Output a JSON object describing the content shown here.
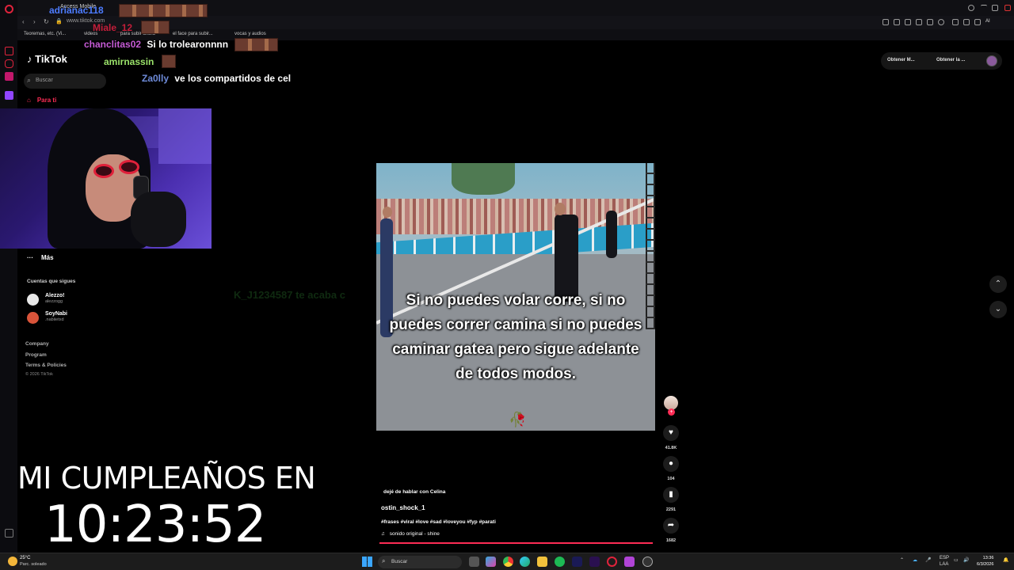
{
  "browser": {
    "tab_title": "Access Mobile",
    "url": "www.tiktok.com",
    "bookmarks": [
      "Teoremas, etc. (Vi...",
      "videos",
      "para subir ahora",
      "el face para subir...",
      "vocas y audios"
    ]
  },
  "tiktok": {
    "logo": "TikTok",
    "search_placeholder": "Buscar",
    "nav_home": "Para ti",
    "nav_more": "Más",
    "following_title": "Cuentas que sigues",
    "following": [
      {
        "name": "Alezzo!",
        "handle": "alezzogg"
      },
      {
        "name": "SoyNabi",
        "handle": ".nabiietxd"
      }
    ],
    "footer": [
      "Company",
      "Program",
      "Terms & Policies"
    ],
    "copyright": "© 2026 TikTok",
    "top_buttons": [
      "Obtener M...",
      "Obtener la ..."
    ]
  },
  "chat": [
    {
      "user": "adrianac118",
      "message": "",
      "color": "#4d7cff"
    },
    {
      "user": "Miale_12",
      "message": "",
      "color": "#c41e3a"
    },
    {
      "user": "chanclitas02",
      "message": "Si lo trolearonnnn",
      "color": "#c65bd6"
    },
    {
      "user": "amirnassin",
      "message": "",
      "color": "#9be36a"
    },
    {
      "user": "Za0lly",
      "message": "ve los compartidos de cel",
      "color": "#6e8bd9"
    }
  ],
  "ghost_chat": "K_J1234587 te acaba c",
  "video": {
    "caption": "Si no puedes volar corre, si no puedes correr camina si no puedes caminar gatea pero sigue adelante de todos modos.",
    "top_text": "dejé de hablar con Celina",
    "author": "ostin_shock_1",
    "hashtags": "#frases #viral #love #sad #loveyou #fyp #parati",
    "sound": "sonido original - shine",
    "likes": "41.8K",
    "comments": "104",
    "saves": "2291",
    "shares": "1682",
    "progress": 1.0
  },
  "overlay": {
    "birthday_label": "MI CUMPLEAÑOS EN",
    "countdown": "10:23:52"
  },
  "taskbar": {
    "weather_temp": "25°C",
    "weather_desc": "Parc. soleado",
    "search": "Buscar",
    "lang_top": "ESP",
    "lang_bottom": "LAA",
    "time": "13:36",
    "date": "6/3/2026"
  },
  "colors": {
    "accent": "#fe2c55",
    "background": "#000000"
  }
}
